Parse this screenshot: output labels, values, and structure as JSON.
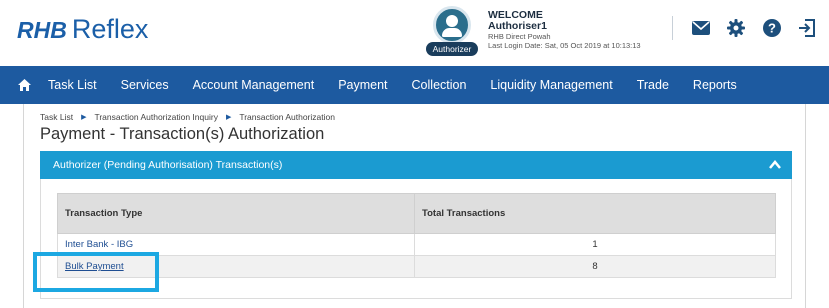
{
  "header": {
    "logo_brand": "RHB",
    "logo_product": "Reflex",
    "role_badge": "Authorizer",
    "welcome": {
      "line1": "WELCOME",
      "line2": "Authoriser1",
      "line3": "RHB Direct Powah",
      "line4": "Last Login Date: Sat, 05 Oct 2019 at 10:13:13"
    },
    "icons": [
      "mail-icon",
      "gear-icon",
      "help-icon",
      "logout-icon"
    ]
  },
  "nav": {
    "items": [
      "Task List",
      "Services",
      "Account Management",
      "Payment",
      "Collection",
      "Liquidity Management",
      "Trade",
      "Reports"
    ]
  },
  "breadcrumb": {
    "items": [
      "Task List",
      "Transaction Authorization Inquiry",
      "Transaction Authorization"
    ]
  },
  "page_title": "Payment - Transaction(s) Authorization",
  "panel": {
    "title": "Authorizer (Pending Authorisation) Transaction(s)"
  },
  "table": {
    "headers": [
      "Transaction Type",
      "Total Transactions"
    ],
    "rows": [
      {
        "type": "Inter Bank - IBG",
        "total": "1"
      },
      {
        "type": "Bulk Payment",
        "total": "8"
      }
    ]
  },
  "colors": {
    "nav_bg": "#1d5aa0",
    "panel_header_bg": "#1b9bd1",
    "highlight": "#1ca8e2",
    "brand": "#1b5fa8"
  }
}
